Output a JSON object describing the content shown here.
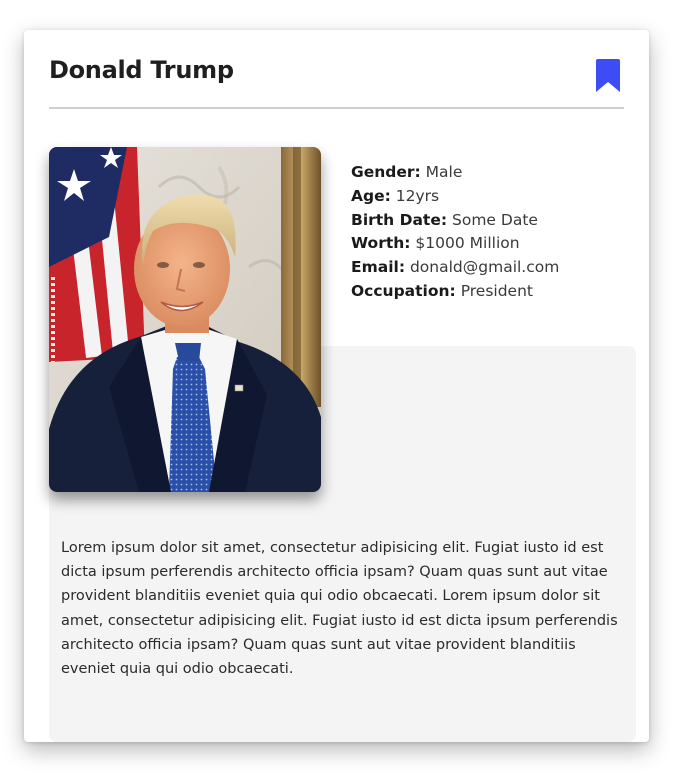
{
  "profile": {
    "name": "Donald Trump",
    "bookmark_icon": "bookmark-icon",
    "accent_color": "#3d4cf5",
    "details": [
      {
        "label": "Gender:",
        "value": "Male"
      },
      {
        "label": "Age:",
        "value": "12yrs"
      },
      {
        "label": "Birth Date:",
        "value": "Some Date"
      },
      {
        "label": "Worth:",
        "value": "$1000 Million"
      },
      {
        "label": "Email:",
        "value": "donald@gmail.com"
      },
      {
        "label": "Occupation:",
        "value": "President"
      }
    ],
    "bio": "Lorem ipsum dolor sit amet, consectetur adipisicing elit. Fugiat iusto id est dicta ipsum perferendis architecto officia ipsam? Quam quas sunt aut vitae provident blanditiis eveniet quia qui odio obcaecati. Lorem ipsum dolor sit amet, consectetur adipisicing elit. Fugiat iusto id est dicta ipsum perferendis architecto officia ipsam? Quam quas sunt aut vitae provident blanditiis eveniet quia qui odio obcaecati."
  }
}
